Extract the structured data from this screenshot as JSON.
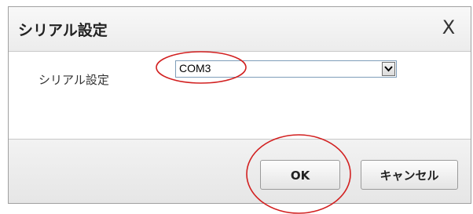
{
  "dialog": {
    "title": "シリアル設定",
    "close_label": "X"
  },
  "form": {
    "serial_label": "シリアル設定",
    "serial_select_value": "COM3",
    "dropdown_arrow": "▾"
  },
  "buttons": {
    "ok_label": "OK",
    "cancel_label": "キャンセル"
  },
  "colors": {
    "annotation": "#d22020"
  }
}
